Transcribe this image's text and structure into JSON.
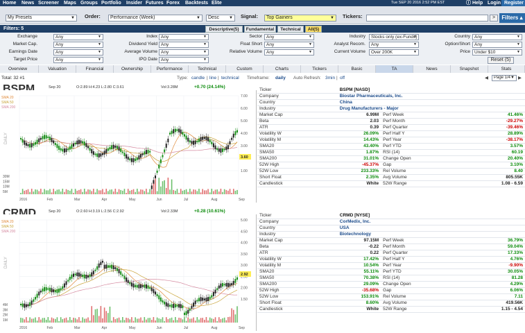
{
  "nav": {
    "items": [
      "Home",
      "News",
      "Screener",
      "Maps",
      "Groups",
      "Portfolio",
      "Insider",
      "Futures",
      "Forex",
      "Backtests",
      "Elite"
    ],
    "datetime": "Tue SEP 20 2016 2:52 PM EST",
    "help": "Help",
    "login": "Login",
    "register": "Register"
  },
  "toolbar": {
    "presets": "My Presets",
    "order_label": "Order:",
    "order_value": "Performance (Week)",
    "order_dir": "Desc",
    "signal_label": "Signal:",
    "signal_value": "Top Gainers",
    "tickers_label": "Tickers:",
    "go_label": ">",
    "filters_button": "Filters ▴"
  },
  "filters": {
    "title": "Filters: 5",
    "tabs": [
      "Descriptive(5)",
      "Fundamental",
      "Technical",
      "All(5)"
    ],
    "rows": [
      [
        [
          "Exchange",
          "Any"
        ],
        [
          "Index",
          "Any"
        ],
        [
          "Sector",
          "Any"
        ],
        [
          "Industry",
          "Stocks only (ex-Funds)"
        ],
        [
          "Country",
          "Any"
        ]
      ],
      [
        [
          "Market Cap.",
          "Any"
        ],
        [
          "Dividend Yield",
          "Any"
        ],
        [
          "Float Short",
          "Any"
        ],
        [
          "Analyst Recom.",
          "Any"
        ],
        [
          "Option/Short",
          "Any"
        ]
      ],
      [
        [
          "Earnings Date",
          "Any"
        ],
        [
          "Average Volume",
          "Any"
        ],
        [
          "Relative Volume",
          "Any"
        ],
        [
          "Current Volume",
          "Over 200K"
        ],
        [
          "Price",
          "Under $10"
        ]
      ],
      [
        [
          "Target Price",
          "Any"
        ],
        [
          "IPO Date",
          "Any"
        ]
      ]
    ],
    "reset": "Reset (5)"
  },
  "view_tabs": [
    "Overview",
    "Valuation",
    "Financial",
    "Ownership",
    "Performance",
    "Technical",
    "Custom",
    "Charts",
    "Tickers",
    "Basic",
    "TA",
    "News",
    "Snapshot",
    "Stats"
  ],
  "info": {
    "total": "Total: 32 #1",
    "type_label": "Type:",
    "type_candle": "candle",
    "type_line": "line",
    "type_technical": "technical",
    "timeframe_label": "Timeframe:",
    "timeframe": "daily",
    "refresh_label": "Auto Refresh:",
    "refresh_on": "3min",
    "refresh_off": "off",
    "page": "Page 1/4"
  },
  "stocks": [
    {
      "ticker": "BSPM",
      "chart_header": {
        "date": "Sep 20",
        "ohlc": "O:2.89  H:4.23  L:2.80  C:3.61",
        "volume": "Vol:3.28M",
        "change": "+0.70 (24.14%)"
      },
      "sma_labels": [
        "SMA 20",
        "SMA 50",
        "SMA 200"
      ],
      "price_ticks": [
        "7.00",
        "6.00",
        "5.00",
        "4.00",
        "3.00",
        "2.00",
        "1.00"
      ],
      "last_price": "3.60",
      "volume_ticks": [
        "30M",
        "15M",
        "10M",
        "5M"
      ],
      "x_labels": [
        "2016",
        "Feb",
        "Mar",
        "Apr",
        "May",
        "Jun",
        "Jul",
        "Aug",
        "Sep"
      ],
      "rows": [
        [
          "Ticker",
          "BSPM [NASD]",
          "",
          ""
        ],
        [
          "Company",
          "Biostar Pharmaceuticals, Inc.",
          "",
          ""
        ],
        [
          "Country",
          "China",
          "",
          ""
        ],
        [
          "Industry",
          "Drug Manufacturers - Major",
          "",
          ""
        ],
        [
          "Market Cap",
          "6.99M",
          "Perf Week",
          "41.46%"
        ],
        [
          "Beta",
          "2.03",
          "Perf Month",
          "-29.27%"
        ],
        [
          "ATR",
          "0.39",
          "Perf Quarter",
          "-39.46%"
        ],
        [
          "Volatility W",
          "26.09%",
          "Perf Half Y",
          "28.89%"
        ],
        [
          "Volatility M",
          "14.43%",
          "Perf Year",
          "-38.17%"
        ],
        [
          "SMA20",
          "43.40%",
          "Perf YTD",
          "3.57%"
        ],
        [
          "SMA50",
          "1.87%",
          "RSI (14)",
          "60.19"
        ],
        [
          "SMA200",
          "31.01%",
          "Change Open",
          "20.40%"
        ],
        [
          "52W High",
          "-45.37%",
          "Gap",
          "3.10%"
        ],
        [
          "52W Low",
          "233.33%",
          "Rel Volume",
          "8.40"
        ],
        [
          "Short Float",
          "2.35%",
          "Avg Volume",
          "805.55K"
        ],
        [
          "Candlestick",
          "White",
          "52W Range",
          "1.08 - 6.59"
        ]
      ]
    },
    {
      "ticker": "CRMD",
      "chart_header": {
        "date": "Sep 20",
        "ohlc": "O:2.60  H:3.19  L:2.56  C:2.92",
        "volume": "Vol:2.33M",
        "change": "+0.28 (10.61%)"
      },
      "sma_labels": [
        "SMA 20",
        "SMA 50",
        "SMA 200"
      ],
      "price_ticks": [
        "5.00",
        "4.50",
        "4.00",
        "3.50",
        "3.00",
        "2.50",
        "2.00",
        "1.50"
      ],
      "last_price": "2.92",
      "volume_ticks": [
        "4M",
        "3M",
        "2M",
        "1M"
      ],
      "x_labels": [
        "2016",
        "Feb",
        "Mar",
        "Apr",
        "May",
        "Jun",
        "Jul",
        "Aug",
        "Sep"
      ],
      "rows": [
        [
          "Ticker",
          "CRMD [NYSE]",
          "",
          ""
        ],
        [
          "Company",
          "CorMedix, Inc.",
          "",
          ""
        ],
        [
          "Country",
          "USA",
          "",
          ""
        ],
        [
          "Industry",
          "Biotechnology",
          "",
          ""
        ],
        [
          "Market Cap",
          "97.15M",
          "Perf Week",
          "36.79%"
        ],
        [
          "Beta",
          "-0.22",
          "Perf Month",
          "59.04%"
        ],
        [
          "ATR",
          "0.22",
          "Perf Quarter",
          "17.33%"
        ],
        [
          "Volatility W",
          "17.42%",
          "Perf Half Y",
          "4.76%"
        ],
        [
          "Volatility M",
          "10.54%",
          "Perf Year",
          "-9.90%"
        ],
        [
          "SMA20",
          "55.11%",
          "Perf YTD",
          "30.05%"
        ],
        [
          "SMA50",
          "70.38%",
          "RSI (14)",
          "81.28"
        ],
        [
          "SMA200",
          "29.09%",
          "Change Open",
          "4.29%"
        ],
        [
          "52W High",
          "-35.68%",
          "Gap",
          "6.06%"
        ],
        [
          "52W Low",
          "153.91%",
          "Rel Volume",
          "7.11"
        ],
        [
          "Short Float",
          "8.60%",
          "Avg Volume",
          "419.56K"
        ],
        [
          "Candlestick",
          "White",
          "52W Range",
          "1.15 - 4.54"
        ]
      ]
    }
  ],
  "colors": {
    "nav_bg": "#1f3f66",
    "up": "#1a8f1a",
    "down": "#222222",
    "positive": "#0a8a0a",
    "negative": "#cc0000",
    "highlight": "#ffff99"
  }
}
